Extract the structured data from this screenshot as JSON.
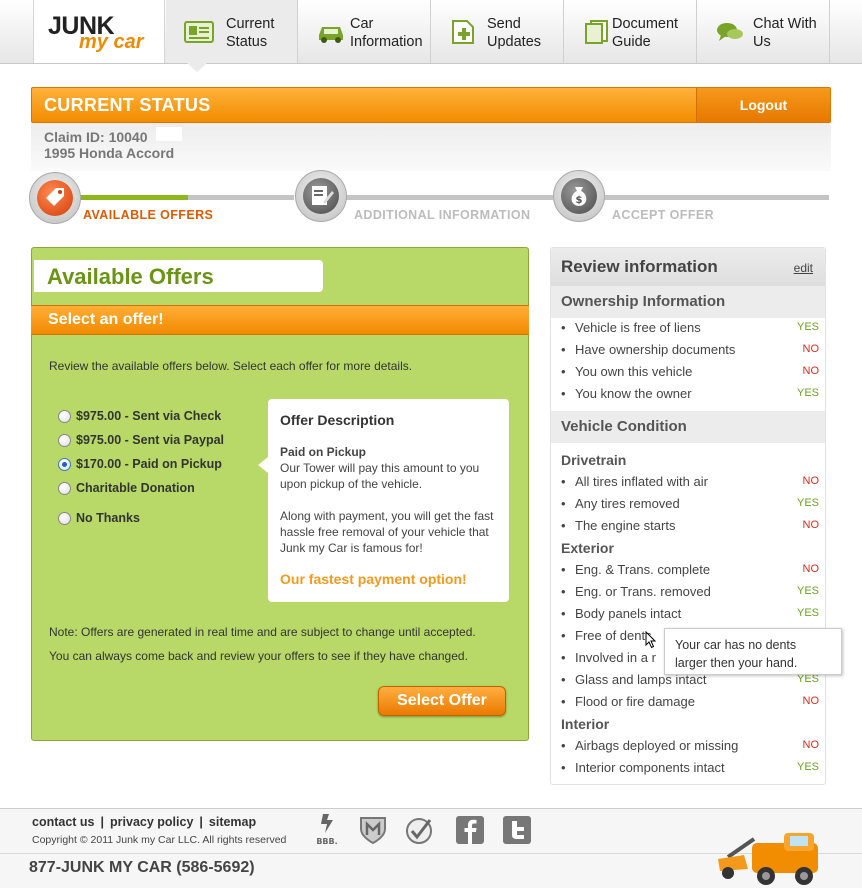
{
  "logo": {
    "line1": "JUNK",
    "line2": "my car"
  },
  "nav": {
    "tabs": [
      {
        "label": "Current Status",
        "icon": "id-card-icon",
        "active": true
      },
      {
        "label": "Car Information",
        "icon": "car-icon",
        "active": false
      },
      {
        "label": "Send Updates",
        "icon": "add-document-icon",
        "active": false
      },
      {
        "label": "Document Guide",
        "icon": "documents-icon",
        "active": false
      },
      {
        "label": "Chat With Us",
        "icon": "chat-bubbles-icon",
        "active": false
      }
    ]
  },
  "status": {
    "title": "CURRENT STATUS",
    "logout": "Logout"
  },
  "claim": {
    "id_line": "Claim ID: 10040",
    "vehicle": "1995 Honda Accord"
  },
  "progress": {
    "steps": [
      {
        "label": "AVAILABLE OFFERS",
        "icon": "price-tag-icon",
        "active": true
      },
      {
        "label": "ADDITIONAL INFORMATION",
        "icon": "form-pencil-icon",
        "active": false
      },
      {
        "label": "ACCEPT OFFER",
        "icon": "money-bag-icon",
        "active": false
      }
    ]
  },
  "offers": {
    "heading": "Available Offers",
    "select_bar": "Select an offer!",
    "intro": "Review the available offers below. Select each offer for more details.",
    "options": [
      {
        "label": "$975.00 - Sent via Check",
        "selected": false
      },
      {
        "label": "$975.00 - Sent via Paypal",
        "selected": false
      },
      {
        "label": "$170.00 - Paid on Pickup",
        "selected": true
      },
      {
        "label": "Charitable Donation",
        "selected": false
      },
      {
        "label": "No Thanks",
        "selected": false
      }
    ],
    "description": {
      "title": "Offer Description",
      "subtitle": "Paid on Pickup",
      "para1": "Our Tower will pay this amount to you upon pickup of the vehicle.",
      "para2": "Along with payment, you will get the fast hassle free removal of your vehicle that Junk my Car is famous for!",
      "highlight": "Our fastest payment option!"
    },
    "note1": "Note: Offers are generated in real time and are subject to change until accepted.",
    "note2": "You can always come back and review your offers to see if they have changed.",
    "button": "Select Offer"
  },
  "review": {
    "title": "Review information",
    "edit": "edit",
    "ownership": {
      "title": "Ownership Information",
      "items": [
        {
          "label": "Vehicle is free of liens",
          "value": "YES"
        },
        {
          "label": "Have ownership documents",
          "value": "NO"
        },
        {
          "label": "You own this vehicle",
          "value": "NO"
        },
        {
          "label": "You know the owner",
          "value": "YES"
        }
      ]
    },
    "condition": {
      "title": "Vehicle Condition",
      "drivetrain": {
        "title": "Drivetrain",
        "items": [
          {
            "label": "All tires inflated with air",
            "value": "NO"
          },
          {
            "label": "Any tires removed",
            "value": "YES"
          },
          {
            "label": "The engine starts",
            "value": "NO"
          }
        ]
      },
      "exterior": {
        "title": "Exterior",
        "items": [
          {
            "label": "Eng. & Trans. complete",
            "value": "NO"
          },
          {
            "label": "Eng. or Trans. removed",
            "value": "YES"
          },
          {
            "label": "Body panels intact",
            "value": "YES"
          },
          {
            "label": "Free of dents",
            "value": ""
          },
          {
            "label": "Involved in a r",
            "value": ""
          },
          {
            "label": "Glass and lamps intact",
            "value": "YES"
          },
          {
            "label": "Flood or fire damage",
            "value": "NO"
          }
        ]
      },
      "interior": {
        "title": "Interior",
        "items": [
          {
            "label": "Airbags deployed or missing",
            "value": "NO"
          },
          {
            "label": "Interior components intact",
            "value": "YES"
          }
        ]
      }
    },
    "tooltip": "Your car has no dents larger then your hand."
  },
  "footer": {
    "links": [
      "contact us",
      "privacy policy",
      "sitemap"
    ],
    "copyright": "Copyright © 2011 Junk my Car LLC. All rights reserved",
    "phone": "877-JUNK MY CAR (586-5692)",
    "icons": [
      "bbb-icon",
      "shield-m-icon",
      "checkmark-seal-icon",
      "facebook-icon",
      "twitter-icon",
      "tow-truck-icon"
    ],
    "bbb_text": "BBB."
  },
  "colors": {
    "orange": "#f28c00",
    "green_panel": "#b8d967",
    "green_text": "#6a9414",
    "yes": "#6aa51c",
    "no": "#e02a14"
  }
}
